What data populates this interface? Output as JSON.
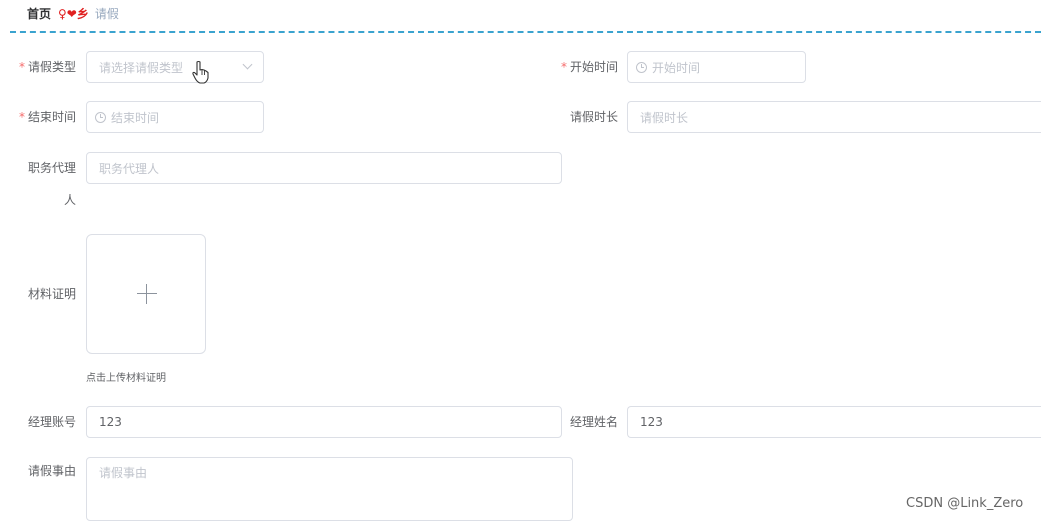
{
  "breadcrumb": {
    "home": "首页",
    "separator": "♀❤乡",
    "current": "请假"
  },
  "form": {
    "leave_type": {
      "label": "请假类型",
      "placeholder": "请选择请假类型",
      "required": true
    },
    "start_time": {
      "label": "开始时间",
      "placeholder": "开始时间",
      "required": true
    },
    "end_time": {
      "label": "结束时间",
      "placeholder": "结束时间",
      "required": true
    },
    "duration": {
      "label": "请假时长",
      "placeholder": "请假时长"
    },
    "agent": {
      "label_line1": "职务代理",
      "label_line2": "人",
      "placeholder": "职务代理人"
    },
    "material": {
      "label": "材料证明",
      "tip": "点击上传材料证明"
    },
    "manager_account": {
      "label": "经理账号",
      "value": "123"
    },
    "manager_name": {
      "label": "经理姓名",
      "value": "123"
    },
    "reason": {
      "label": "请假事由",
      "placeholder": "请假事由"
    }
  },
  "required_mark": "*",
  "watermark": "CSDN @Link_Zero",
  "icons": [
    "clock-icon",
    "chevron-down-icon",
    "plus-icon",
    "hand-cursor-icon"
  ],
  "colors": {
    "required": "#f56c6c",
    "divider": "#3aa3cf",
    "border": "#dcdfe6",
    "placeholder": "#c0c4cc"
  }
}
